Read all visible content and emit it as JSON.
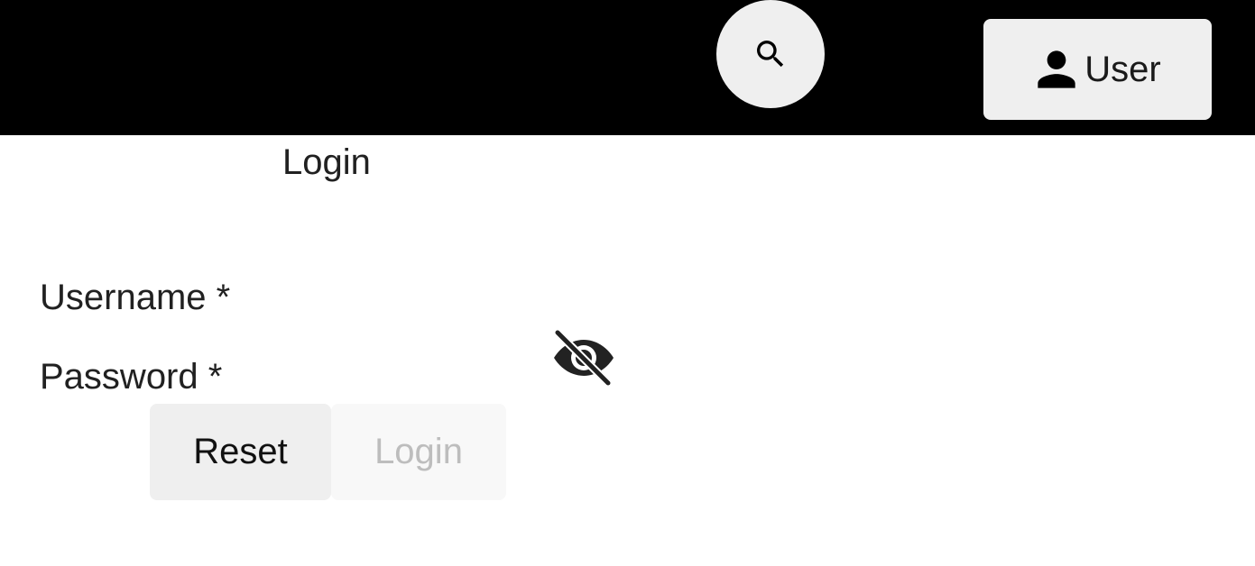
{
  "header": {
    "background": "#000000",
    "search_icon": "search-icon",
    "user_icon": "person-icon",
    "user_label": "User"
  },
  "form": {
    "title": "Login",
    "username_label": "Username *",
    "password_label": "Password *",
    "password_toggle_icon": "eye-off-icon",
    "reset_label": "Reset",
    "login_label": "Login",
    "login_disabled": true
  },
  "colors": {
    "button_bg": "#efefef",
    "disabled_bg": "#f8f8f8",
    "disabled_text": "#bdbdbd",
    "text": "#212121"
  }
}
